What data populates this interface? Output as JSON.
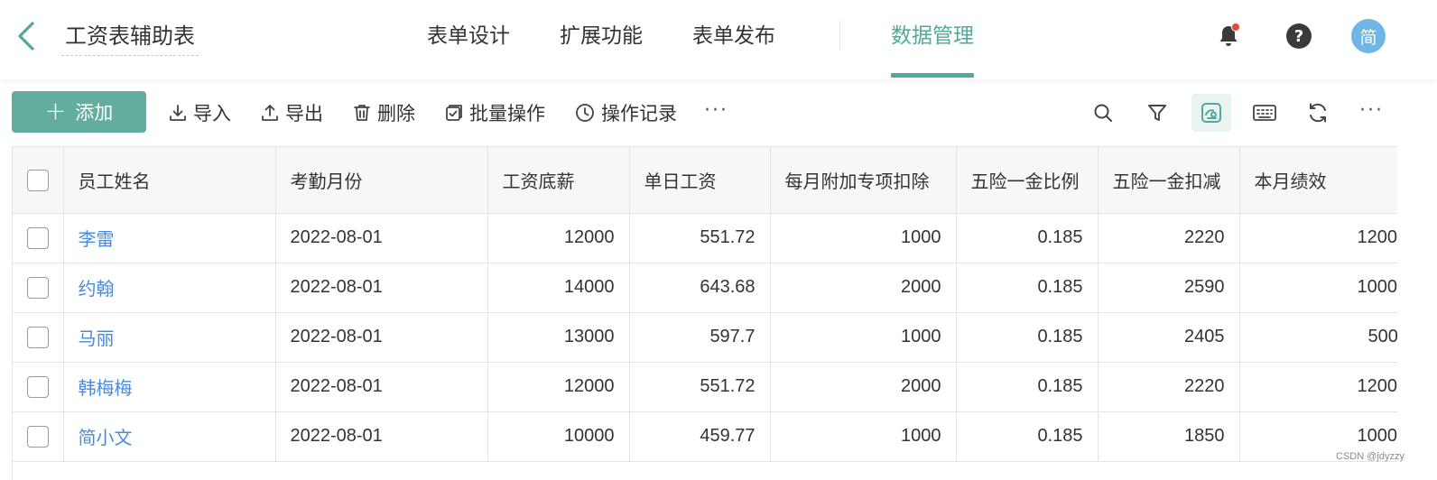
{
  "header": {
    "title": "工资表辅助表",
    "nav": [
      {
        "label": "表单设计"
      },
      {
        "label": "扩展功能"
      },
      {
        "label": "表单发布"
      },
      {
        "label": "数据管理",
        "active": true
      }
    ],
    "avatar_text": "简",
    "help_text": "?"
  },
  "toolbar": {
    "add_label": "添加",
    "import_label": "导入",
    "export_label": "导出",
    "delete_label": "删除",
    "batch_label": "批量操作",
    "log_label": "操作记录",
    "more_label": "···",
    "right_more_label": "···"
  },
  "table": {
    "columns": [
      "员工姓名",
      "考勤月份",
      "工资底薪",
      "单日工资",
      "每月附加专项扣除",
      "五险一金比例",
      "五险一金扣减",
      "本月绩效"
    ],
    "rows": [
      {
        "name": "李雷",
        "month": "2022-08-01",
        "base": "12000",
        "daily": "551.72",
        "deduct": "1000",
        "ratio": "0.185",
        "insurance": "2220",
        "perf": "1200"
      },
      {
        "name": "约翰",
        "month": "2022-08-01",
        "base": "14000",
        "daily": "643.68",
        "deduct": "2000",
        "ratio": "0.185",
        "insurance": "2590",
        "perf": "1000"
      },
      {
        "name": "马丽",
        "month": "2022-08-01",
        "base": "13000",
        "daily": "597.7",
        "deduct": "1000",
        "ratio": "0.185",
        "insurance": "2405",
        "perf": "500"
      },
      {
        "name": "韩梅梅",
        "month": "2022-08-01",
        "base": "12000",
        "daily": "551.72",
        "deduct": "2000",
        "ratio": "0.185",
        "insurance": "2220",
        "perf": "1200"
      },
      {
        "name": "简小文",
        "month": "2022-08-01",
        "base": "10000",
        "daily": "459.77",
        "deduct": "1000",
        "ratio": "0.185",
        "insurance": "1850",
        "perf": "1000"
      }
    ]
  },
  "watermark": "CSDN @jdyzzy",
  "colors": {
    "accent": "#63ad9f",
    "link": "#4a89dc",
    "badge": "#e5493a",
    "avatar": "#6fb6e6"
  }
}
